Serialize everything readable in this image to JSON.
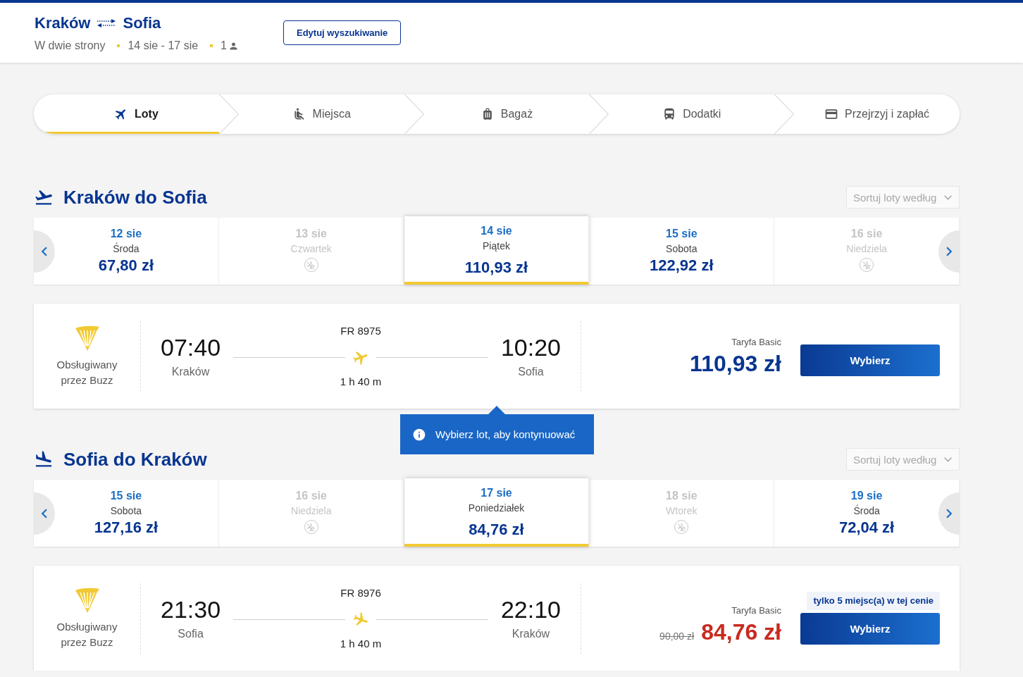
{
  "header": {
    "origin": "Kraków",
    "destination": "Sofia",
    "trip_type": "W dwie strony",
    "dates": "14 sie - 17 sie",
    "passengers": "1",
    "edit_button": "Edytuj wyszukiwanie"
  },
  "steps": [
    {
      "label": "Loty",
      "kind": "flights",
      "selected": true
    },
    {
      "label": "Miejsca",
      "kind": "seats",
      "selected": false
    },
    {
      "label": "Bagaż",
      "kind": "bags",
      "selected": false
    },
    {
      "label": "Dodatki",
      "kind": "extras",
      "selected": false
    },
    {
      "label": "Przejrzyj i zapłać",
      "kind": "payment",
      "selected": false
    }
  ],
  "sections": [
    {
      "kind": "outbound",
      "title": "Kraków do Sofia",
      "sort_label": "Sortuj loty według",
      "dates": [
        {
          "date": "12 sie",
          "weekday": "Środa",
          "price": "67,80 zł",
          "available": true,
          "selected": false
        },
        {
          "date": "13 sie",
          "weekday": "Czwartek",
          "available": false,
          "selected": false
        },
        {
          "date": "14 sie",
          "weekday": "Piątek",
          "price": "110,93 zł",
          "available": true,
          "selected": true
        },
        {
          "date": "15 sie",
          "weekday": "Sobota",
          "price": "122,92 zł",
          "available": true,
          "selected": false
        },
        {
          "date": "16 sie",
          "weekday": "Niedziela",
          "available": false,
          "selected": false
        }
      ],
      "flight": {
        "operator": "Obsługiwany przez Buzz",
        "departure_time": "07:40",
        "departure_city": "Kraków",
        "flight_number": "FR 8975",
        "duration": "1 h 40 m",
        "arrival_time": "10:20",
        "arrival_city": "Sofia",
        "fare": "Taryfa Basic",
        "price": "110,93 zł",
        "button": "Wybierz"
      },
      "tooltip": "Wybierz lot, aby kontynuować"
    },
    {
      "kind": "return",
      "title": "Sofia do Kraków",
      "sort_label": "Sortuj loty według",
      "dates": [
        {
          "date": "15 sie",
          "weekday": "Sobota",
          "price": "127,16 zł",
          "available": true,
          "selected": false
        },
        {
          "date": "16 sie",
          "weekday": "Niedziela",
          "available": false,
          "selected": false
        },
        {
          "date": "17 sie",
          "weekday": "Poniedziałek",
          "price": "84,76 zł",
          "available": true,
          "selected": true
        },
        {
          "date": "18 sie",
          "weekday": "Wtorek",
          "available": false,
          "selected": false
        },
        {
          "date": "19 sie",
          "weekday": "Środa",
          "price": "72,04 zł",
          "available": true,
          "selected": false
        }
      ],
      "flight": {
        "operator": "Obsługiwany przez Buzz",
        "departure_time": "21:30",
        "departure_city": "Sofia",
        "flight_number": "FR 8976",
        "duration": "1 h 40 m",
        "arrival_time": "22:10",
        "arrival_city": "Kraków",
        "fare": "Taryfa Basic",
        "old_price": "90,00 zł",
        "price": "84,76 zł",
        "badge": "tylko 5 miejsc(a) w tej cenie",
        "button": "Wybierz"
      }
    }
  ]
}
